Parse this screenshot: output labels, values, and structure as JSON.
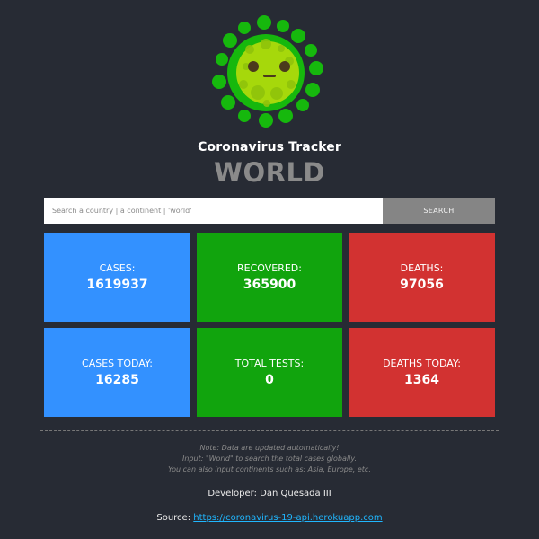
{
  "app": {
    "title": "Coronavirus Tracker",
    "region": "WORLD"
  },
  "logo": {
    "icon": "virus-icon",
    "colors": {
      "outer": "#16b80d",
      "inner": "#a6d80b",
      "eyes": "#4b3a1c"
    }
  },
  "search": {
    "placeholder": "Search a country | a continent | 'world'",
    "value": "",
    "button_label": "SEARCH"
  },
  "stats": {
    "cases": {
      "label": "CASES:",
      "value": "1619937"
    },
    "recovered": {
      "label": "RECOVERED:",
      "value": "365900"
    },
    "deaths": {
      "label": "DEATHS:",
      "value": "97056"
    },
    "cases_today": {
      "label": "CASES TODAY:",
      "value": "16285"
    },
    "total_tests": {
      "label": "TOTAL TESTS:",
      "value": "0"
    },
    "deaths_today": {
      "label": "DEATHS TODAY:",
      "value": "1364"
    }
  },
  "notes": {
    "line1": "Note: Data are updated automatically!",
    "line2": "Input: \"World\" to search the total cases globally.",
    "line3": "You can also input continents such as: Asia, Europe, etc."
  },
  "footer": {
    "developer": "Developer: Dan Quesada III",
    "source_label": "Source: ",
    "source_link": "https://coronavirus-19-api.herokuapp.com"
  },
  "colors": {
    "background": "#272b34",
    "blue": "#3391ff",
    "green": "#11a40d",
    "red": "#d23231",
    "link": "#20b7ff",
    "muted": "#8a8a8a"
  }
}
